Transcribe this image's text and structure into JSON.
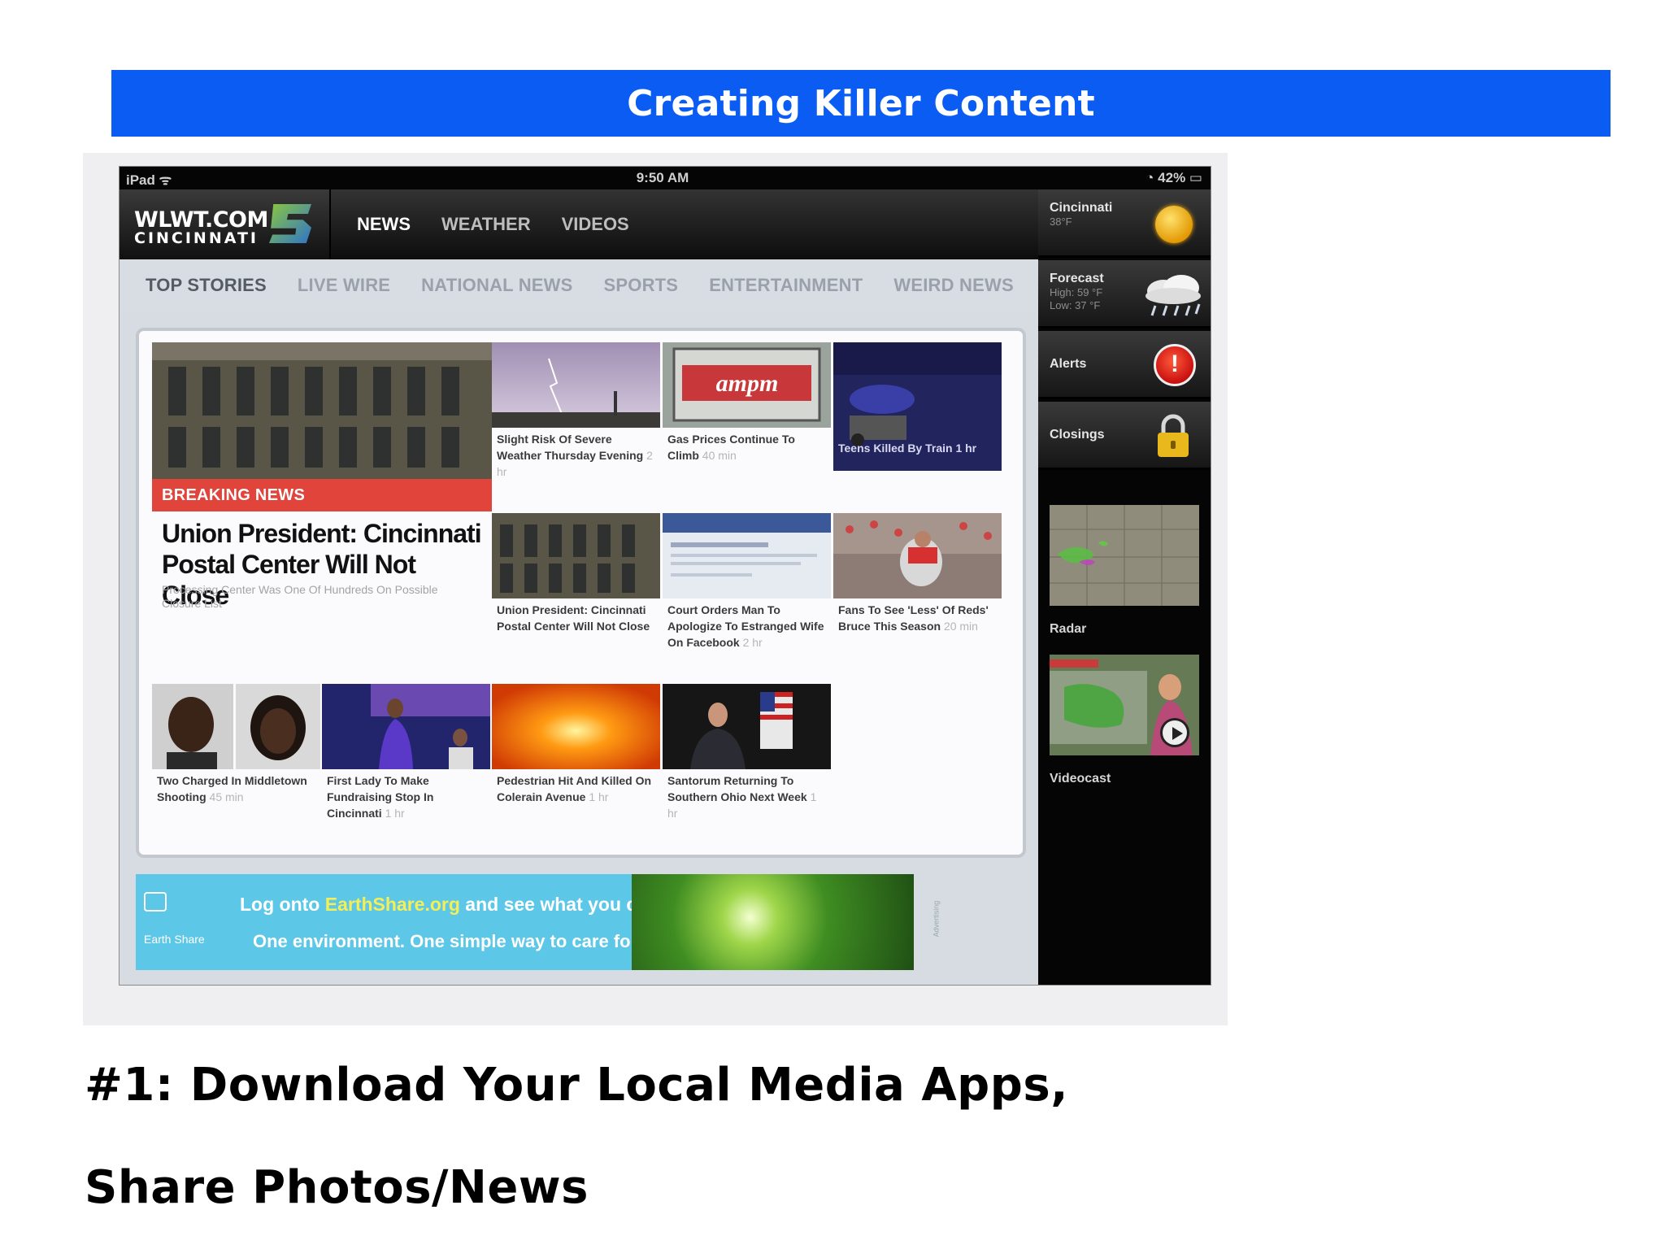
{
  "slide": {
    "title": "Creating Killer Content",
    "heading_line1": "#1: Download Your Local Media Apps,",
    "heading_line2": "Share Photos/News"
  },
  "ipad": {
    "status_left": "iPad ᯤ",
    "status_time": "9:50 AM",
    "status_battery": "42%"
  },
  "app": {
    "logo_line1": "WLWT.COM",
    "logo_line2": "CINCINNATI",
    "nav": [
      "NEWS",
      "WEATHER",
      "VIDEOS"
    ],
    "subnav": [
      "TOP STORIES",
      "LIVE WIRE",
      "NATIONAL NEWS",
      "SPORTS",
      "ENTERTAINMENT",
      "WEIRD NEWS"
    ]
  },
  "sidebar": {
    "city": "Cincinnati",
    "temp": "38°F",
    "forecast_title": "Forecast",
    "forecast_high": "High: 59 °F",
    "forecast_low": "Low: 37 °F",
    "alerts": "Alerts",
    "closings": "Closings",
    "radar": "Radar",
    "videocast": "Videocast"
  },
  "lead": {
    "badge": "BREAKING NEWS",
    "headline": "Union President: Cincinnati Postal Center Will Not Close",
    "sub": "Processing Center Was One Of Hundreds On Possible Closure List"
  },
  "stories": [
    {
      "title": "Slight Risk Of Severe Weather Thursday Evening",
      "time": "2 hr"
    },
    {
      "title": "Gas Prices Continue To Climb",
      "time": "40 min"
    },
    {
      "title": "Teens Killed By Train",
      "time": "1 hr"
    },
    {
      "title": "Union President: Cincinnati Postal Center Will Not Close",
      "time": ""
    },
    {
      "title": "Court Orders Man To Apologize To Estranged Wife On Facebook",
      "time": "2 hr"
    },
    {
      "title": "Fans To See 'Less' Of Reds' Bruce This Season",
      "time": "20 min"
    },
    {
      "title": "Two Charged In Middletown Shooting",
      "time": "45 min"
    },
    {
      "title": "First Lady To Make Fundraising Stop In Cincinnati",
      "time": "1 hr"
    },
    {
      "title": "Pedestrian Hit And Killed On Colerain Avenue",
      "time": "1 hr"
    },
    {
      "title": "Santorum Returning To Southern Ohio Next Week",
      "time": "1 hr"
    }
  ],
  "ad": {
    "line1_pre": "Log onto",
    "line1_link": "EarthShare.org",
    "line1_post": "and see what you can do.",
    "line2": "One environment. One simple way to care for it.®",
    "brand": "Earth Share",
    "vertical": "Advertising"
  },
  "colors": {
    "banner": "#0a5cf2",
    "breaking": "#e0443b",
    "ad": "#5cc7e6"
  }
}
